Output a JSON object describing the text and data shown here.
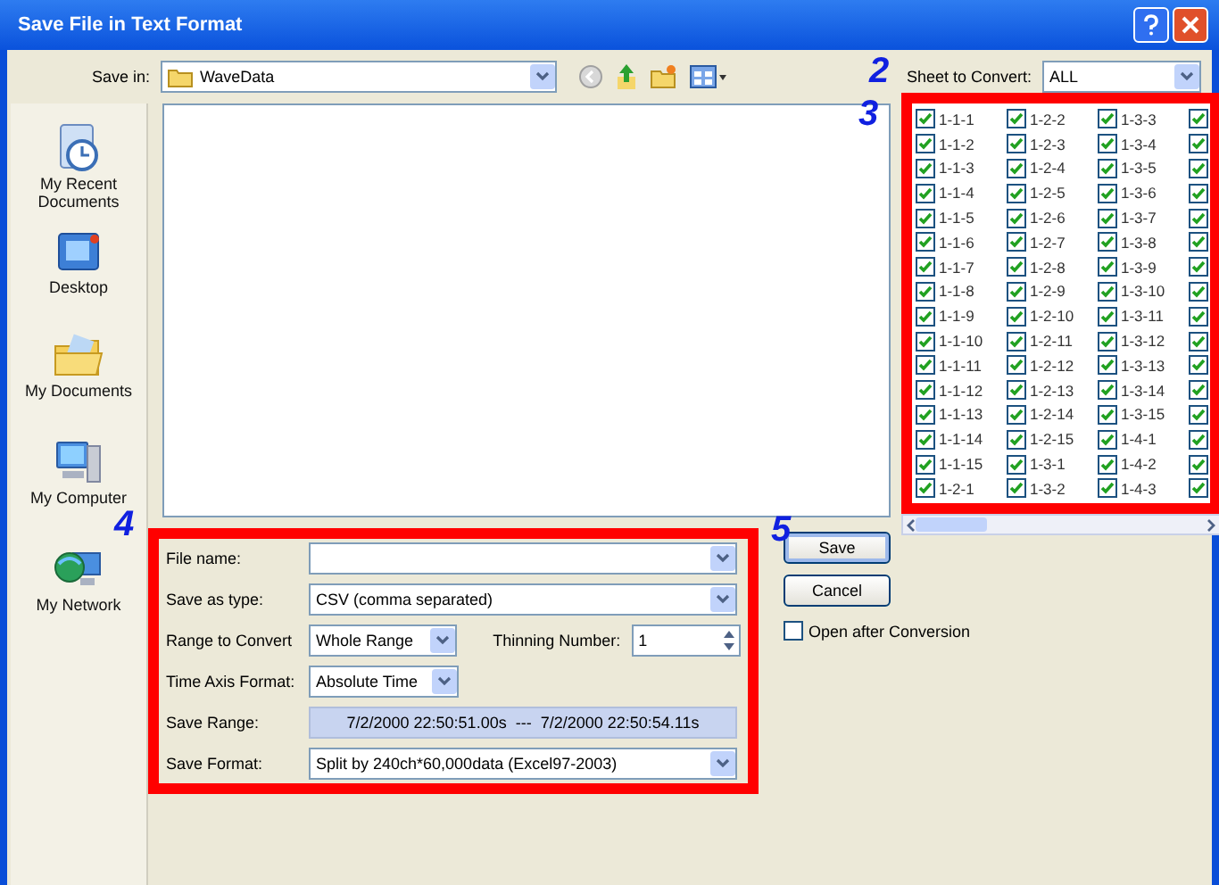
{
  "window": {
    "title": "Save File in Text Format"
  },
  "toolbar": {
    "save_in_label": "Save in:",
    "save_in": "WaveData",
    "sheet_label": "Sheet to Convert:",
    "sheet": "ALL"
  },
  "callouts": {
    "sheet": "2",
    "grid": "3",
    "form": "4",
    "buttons": "5"
  },
  "places": [
    {
      "label": "My Recent Documents",
      "kind": "recent"
    },
    {
      "label": "Desktop",
      "kind": "desktop"
    },
    {
      "label": "My Documents",
      "kind": "documents"
    },
    {
      "label": "My Computer",
      "kind": "computer"
    },
    {
      "label": "My Network",
      "kind": "network"
    }
  ],
  "sheets": {
    "columns": [
      [
        {
          "label": "1-1-1",
          "checked": true
        },
        {
          "label": "1-1-2",
          "checked": true
        },
        {
          "label": "1-1-3",
          "checked": true
        },
        {
          "label": "1-1-4",
          "checked": true
        },
        {
          "label": "1-1-5",
          "checked": true
        },
        {
          "label": "1-1-6",
          "checked": true
        },
        {
          "label": "1-1-7",
          "checked": true
        },
        {
          "label": "1-1-8",
          "checked": true
        },
        {
          "label": "1-1-9",
          "checked": true
        },
        {
          "label": "1-1-10",
          "checked": true
        },
        {
          "label": "1-1-11",
          "checked": true
        },
        {
          "label": "1-1-12",
          "checked": true
        },
        {
          "label": "1-1-13",
          "checked": true
        },
        {
          "label": "1-1-14",
          "checked": true
        },
        {
          "label": "1-1-15",
          "checked": true
        },
        {
          "label": "1-2-1",
          "checked": true
        }
      ],
      [
        {
          "label": "1-2-2",
          "checked": true
        },
        {
          "label": "1-2-3",
          "checked": true
        },
        {
          "label": "1-2-4",
          "checked": true
        },
        {
          "label": "1-2-5",
          "checked": true
        },
        {
          "label": "1-2-6",
          "checked": true
        },
        {
          "label": "1-2-7",
          "checked": true
        },
        {
          "label": "1-2-8",
          "checked": true
        },
        {
          "label": "1-2-9",
          "checked": true
        },
        {
          "label": "1-2-10",
          "checked": true
        },
        {
          "label": "1-2-11",
          "checked": true
        },
        {
          "label": "1-2-12",
          "checked": true
        },
        {
          "label": "1-2-13",
          "checked": true
        },
        {
          "label": "1-2-14",
          "checked": true
        },
        {
          "label": "1-2-15",
          "checked": true
        },
        {
          "label": "1-3-1",
          "checked": true
        },
        {
          "label": "1-3-2",
          "checked": true
        }
      ],
      [
        {
          "label": "1-3-3",
          "checked": true
        },
        {
          "label": "1-3-4",
          "checked": true
        },
        {
          "label": "1-3-5",
          "checked": true
        },
        {
          "label": "1-3-6",
          "checked": true
        },
        {
          "label": "1-3-7",
          "checked": true
        },
        {
          "label": "1-3-8",
          "checked": true
        },
        {
          "label": "1-3-9",
          "checked": true
        },
        {
          "label": "1-3-10",
          "checked": true
        },
        {
          "label": "1-3-11",
          "checked": true
        },
        {
          "label": "1-3-12",
          "checked": true
        },
        {
          "label": "1-3-13",
          "checked": true
        },
        {
          "label": "1-3-14",
          "checked": true
        },
        {
          "label": "1-3-15",
          "checked": true
        },
        {
          "label": "1-4-1",
          "checked": true
        },
        {
          "label": "1-4-2",
          "checked": true
        },
        {
          "label": "1-4-3",
          "checked": true
        }
      ],
      [
        {
          "checked": true
        },
        {
          "checked": true
        },
        {
          "checked": true
        },
        {
          "checked": true
        },
        {
          "checked": true
        },
        {
          "checked": true
        },
        {
          "checked": true
        },
        {
          "checked": true
        },
        {
          "checked": true
        },
        {
          "checked": true
        },
        {
          "checked": true
        },
        {
          "checked": true
        },
        {
          "checked": true
        },
        {
          "checked": true
        },
        {
          "checked": true
        },
        {
          "checked": true
        }
      ]
    ]
  },
  "form": {
    "rows": [
      {
        "kind": "combo",
        "label": "File name:"
      },
      {
        "kind": "combo",
        "label": "Save as type:",
        "value": "CSV (comma separated)"
      },
      {
        "kind": "range",
        "label": "Range to Convert",
        "value": "Whole Range",
        "thinning_label": "Thinning Number:",
        "thinning_value": "1"
      },
      {
        "kind": "small_combo",
        "label": "Time Axis Format:",
        "value": "Absolute Time"
      },
      {
        "kind": "readout",
        "label": "Save Range:",
        "value": "7/2/2000 22:50:51.00s  ---  7/2/2000 22:50:54.11s"
      },
      {
        "kind": "combo",
        "label": "Save Format:",
        "value": "Split by 240ch*60,000data (Excel97-2003)"
      }
    ]
  },
  "buttons": [
    {
      "label": "Save",
      "default": true
    },
    {
      "label": "Cancel",
      "default": false
    }
  ],
  "open_after": {
    "label": "Open after Conversion",
    "checked": false
  }
}
